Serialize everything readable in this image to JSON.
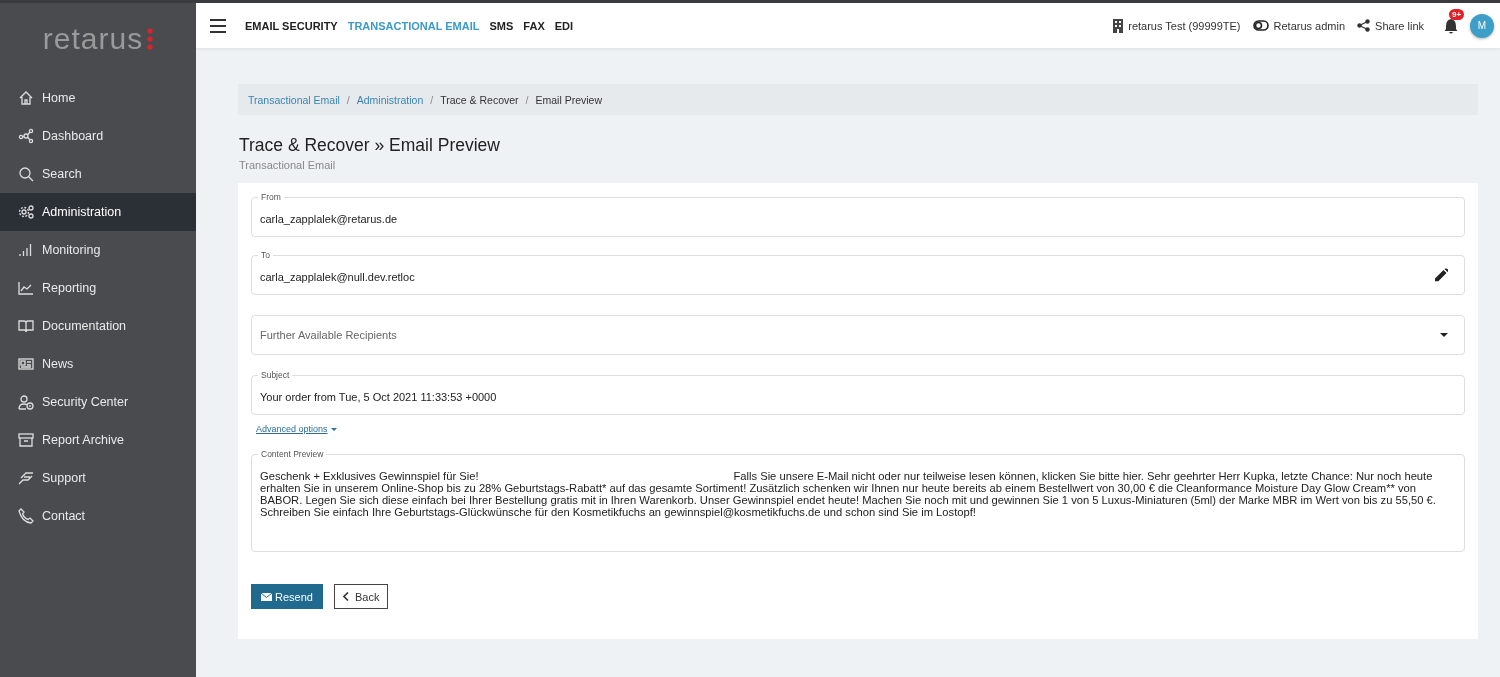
{
  "logo": {
    "text": "retarus"
  },
  "sidebar": {
    "items": [
      {
        "label": "Home",
        "selected": false
      },
      {
        "label": "Dashboard",
        "selected": false
      },
      {
        "label": "Search",
        "selected": false
      },
      {
        "label": "Administration",
        "selected": true
      },
      {
        "label": "Monitoring",
        "selected": false
      },
      {
        "label": "Reporting",
        "selected": false
      },
      {
        "label": "Documentation",
        "selected": false
      },
      {
        "label": "News",
        "selected": false
      },
      {
        "label": "Security Center",
        "selected": false
      },
      {
        "label": "Report Archive",
        "selected": false
      },
      {
        "label": "Support",
        "selected": false
      },
      {
        "label": "Contact",
        "selected": false
      }
    ]
  },
  "topnav": [
    {
      "label": "EMAIL SECURITY",
      "selected": false
    },
    {
      "label": "TRANSACTIONAL EMAIL",
      "selected": true
    },
    {
      "label": "SMS",
      "selected": false
    },
    {
      "label": "FAX",
      "selected": false
    },
    {
      "label": "EDI",
      "selected": false
    }
  ],
  "account": {
    "company": "retarus Test (99999TE)",
    "role": "Retarus admin",
    "share": "Share link",
    "notifications": "9+",
    "avatar": "M"
  },
  "breadcrumb": [
    {
      "label": "Transactional Email",
      "link": true
    },
    {
      "separator": "/",
      "label": "Administration",
      "link": true
    },
    {
      "separator": "/",
      "label": "Trace & Recover",
      "link": false
    },
    {
      "separator": "/",
      "label": "Email Preview",
      "link": false
    }
  ],
  "page": {
    "title": "Trace & Recover » Email Preview",
    "subtitle": "Transactional Email"
  },
  "form": {
    "from": {
      "label": "From",
      "value": "carla_zapplalek@retarus.de"
    },
    "to": {
      "label": "To",
      "value": "carla_zapplalek@null.dev.retloc"
    },
    "recipients": {
      "placeholder": "Further Available Recipients"
    },
    "subject": {
      "label": "Subject",
      "value": "Your order from Tue, 5 Oct 2021 11:33:53 +0000"
    },
    "advanced": "Advanced options",
    "content": {
      "label": "Content Preview",
      "value": "Geschenk + Exklusives Gewinnspiel für Sie!                                                                                  Falls Sie unsere E-Mail nicht oder nur teilweise lesen können, klicken Sie bitte hier. Sehr geehrter Herr Kupka, letzte Chance: Nur noch heute erhalten Sie in unserem Online-Shop bis zu 28% Geburtstags-Rabatt* auf das gesamte Sortiment! Zusätzlich schenken wir Ihnen nur heute bereits ab einem Bestellwert von 30,00 € die Cleanformance Moisture Day Glow Cream** von BABOR. Legen Sie sich diese einfach bei Ihrer Bestellung gratis mit in Ihren Warenkorb. Unser Gewinnspiel endet heute! Machen Sie noch mit und gewinnen Sie 1 von 5 Luxus-Miniaturen (5ml) der Marke MBR im Wert von bis zu 55,50 €. Schreiben Sie einfach Ihre Geburtstags-Glückwünsche für den Kosmetikfuchs an gewinnspiel@kosmetikfuchs.de und schon sind Sie im Lostopf!"
    }
  },
  "buttons": {
    "resend": "Resend",
    "back": "Back"
  }
}
